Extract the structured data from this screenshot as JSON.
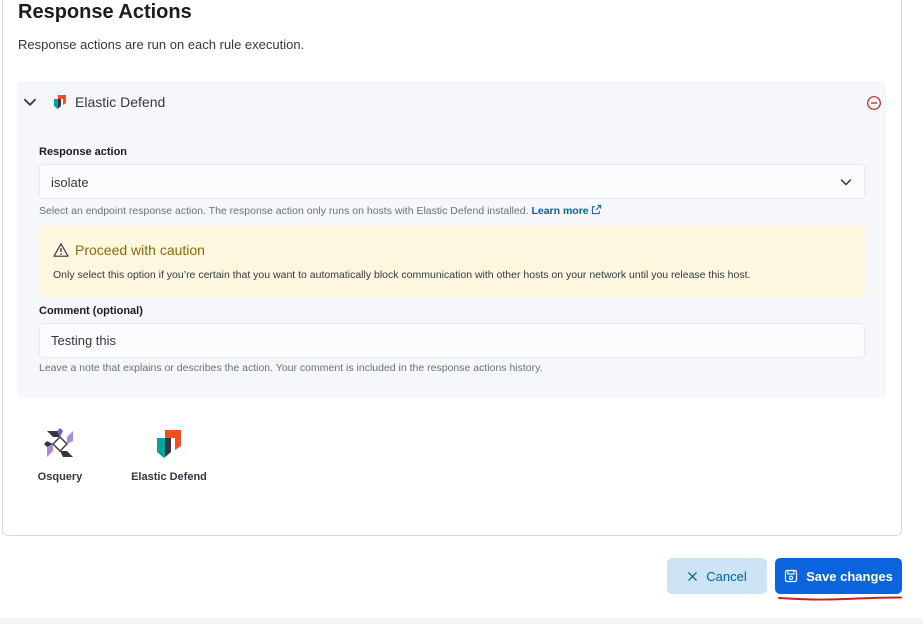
{
  "section": {
    "title": "Response Actions",
    "description": "Response actions are run on each rule execution."
  },
  "accordion": {
    "title": "Elastic Defend",
    "response_action_label": "Response action",
    "response_action_value": "isolate",
    "response_action_help": "Select an endpoint response action. The response action only runs on hosts with Elastic Defend installed.",
    "learn_more": "Learn more",
    "callout": {
      "title": "Proceed with caution",
      "body": "Only select this option if you’re certain that you want to automatically block communication with other hosts on your network until you release this host."
    },
    "comment_label": "Comment (optional)",
    "comment_value": "Testing this",
    "comment_help": "Leave a note that explains or describes the action. Your comment is included in the response actions history."
  },
  "action_types": [
    {
      "label": "Osquery",
      "icon": "osquery-icon"
    },
    {
      "label": "Elastic Defend",
      "icon": "elastic-defend-icon"
    }
  ],
  "footer": {
    "cancel_label": "Cancel",
    "save_label": "Save changes"
  },
  "colors": {
    "primary": "#0b64dd",
    "cancel_bg": "#cce4f5",
    "warning_bg": "#fef7e0",
    "danger": "#bd271e",
    "annotation": "#cc1f1f"
  }
}
